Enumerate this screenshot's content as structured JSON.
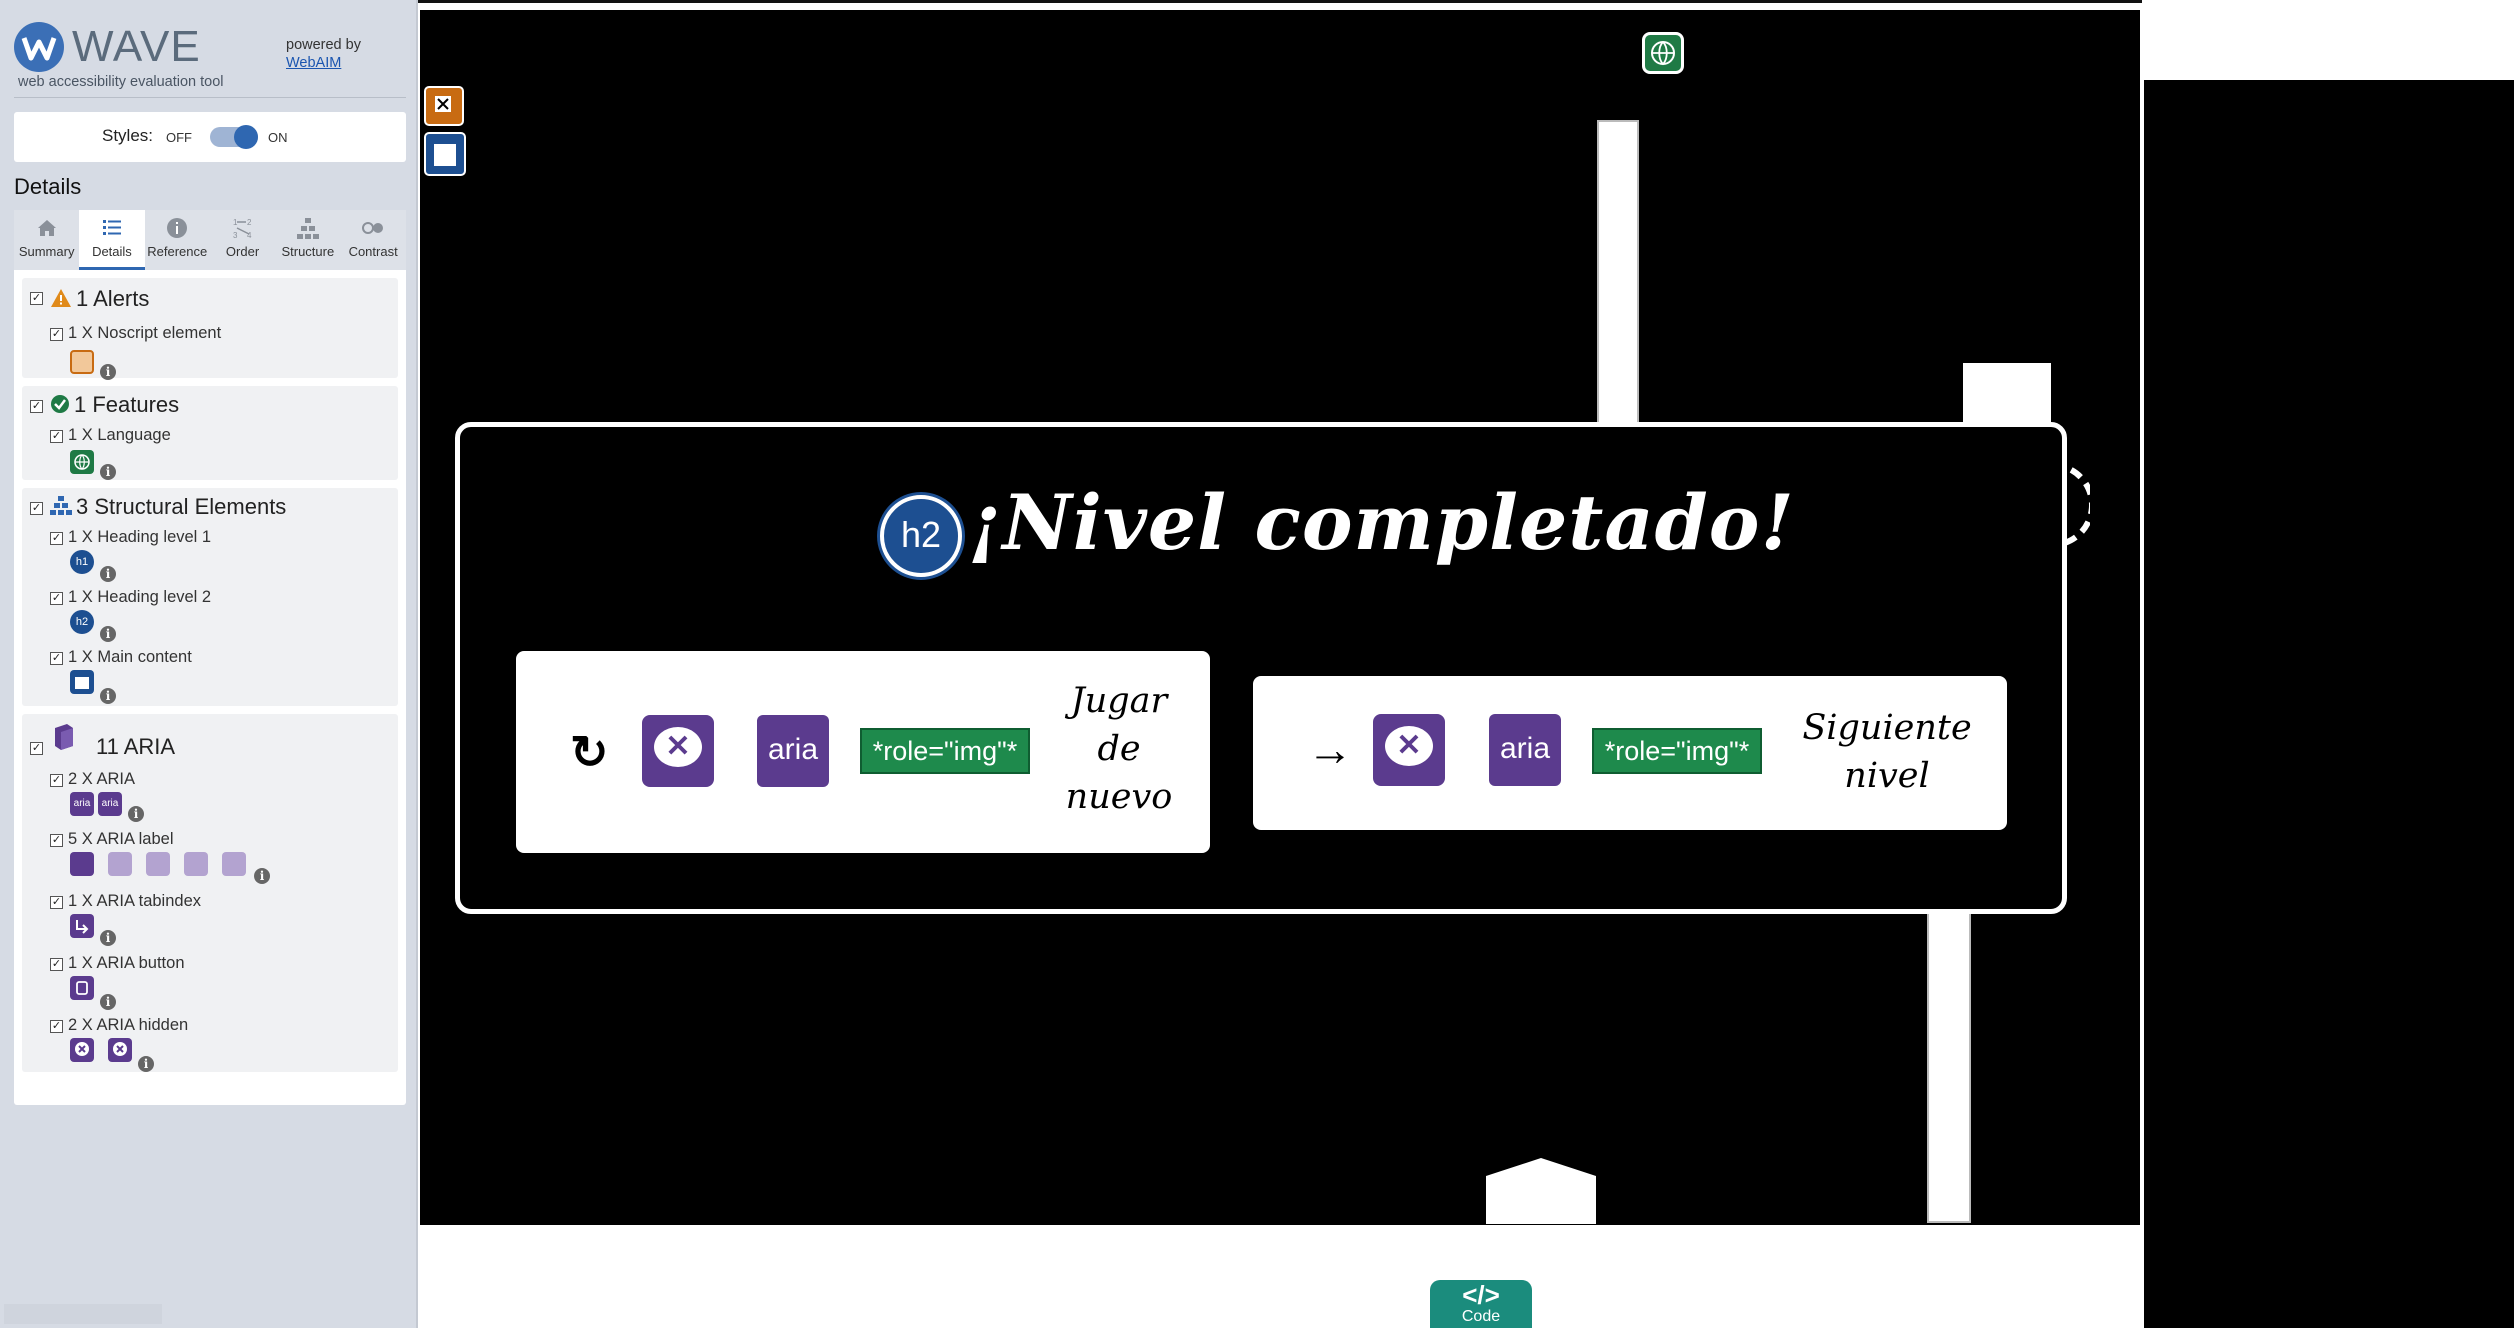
{
  "wave": {
    "title": "WAVE",
    "subtitle": "web accessibility evaluation tool",
    "powered_by": "powered by",
    "webaim_link": "WebAIM",
    "styles_label": "Styles:",
    "styles_off": "OFF",
    "styles_on": "ON",
    "details_heading": "Details",
    "tabs": [
      "Summary",
      "Details",
      "Reference",
      "Order",
      "Structure",
      "Contrast"
    ],
    "groups": {
      "alerts": {
        "title": "1 Alerts",
        "items": [
          "1 X Noscript element"
        ]
      },
      "features": {
        "title": "1 Features",
        "items": [
          "1 X Language"
        ]
      },
      "structural": {
        "title": "3 Structural Elements",
        "items": [
          "1 X Heading level 1",
          "1 X Heading level 2",
          "1 X Main content"
        ]
      },
      "aria": {
        "title": "11 ARIA",
        "items": [
          "2 X ARIA",
          "5 X ARIA label",
          "1 X ARIA tabindex",
          "1 X ARIA button",
          "2 X ARIA hidden"
        ]
      }
    },
    "aria_icon_text": "aria",
    "info_glyph": "i",
    "h1_text": "h1",
    "h2_text": "h2"
  },
  "game": {
    "heading_badge": "h2",
    "dialog_title": "¡Nivel completado!",
    "buttons": [
      {
        "icon": "↻",
        "aria_text": "aria",
        "role_tag": "*role=\"img\"*",
        "label_lines": [
          "Jugar",
          "de",
          "nuevo"
        ]
      },
      {
        "icon": "→",
        "aria_text": "aria",
        "role_tag": "*role=\"img\"*",
        "label_lines": [
          "Siguiente",
          "nivel"
        ]
      }
    ],
    "hidden_glyph": "✕",
    "code_symbol": "</>",
    "code_label": "Code"
  },
  "colors": {
    "wave_blue": "#2f67b1",
    "alert_orange": "#c86b12",
    "feature_green": "#1f7a45",
    "aria_purple": "#5b3b8e",
    "role_green": "#1e8a4c",
    "code_teal": "#1b8c7d"
  }
}
